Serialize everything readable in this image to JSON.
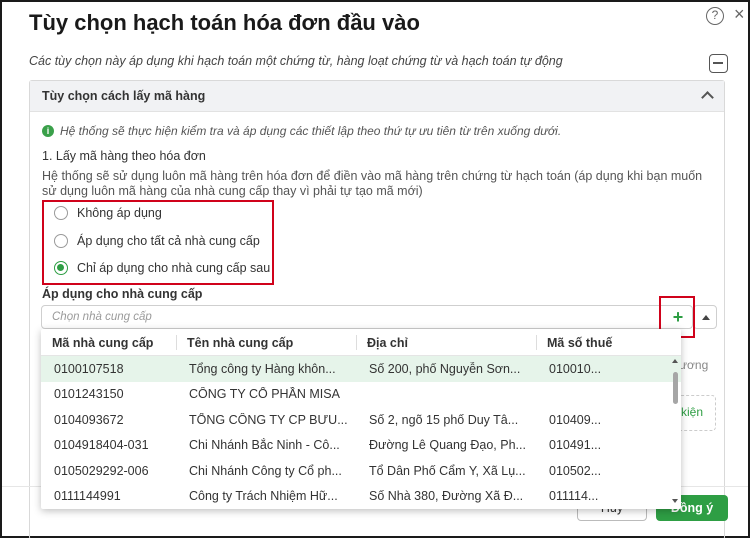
{
  "dialog": {
    "title": "Tùy chọn hạch toán hóa đơn đầu vào",
    "subtitle": "Các tùy chọn này áp dụng khi hạch toán một chứng từ, hàng loạt chứng từ và hạch toán tự động",
    "help_icon": "?",
    "close_icon": "×"
  },
  "section": {
    "title": "Tùy chọn cách lấy mã hàng",
    "info": "Hệ thống sẽ thực hiện kiểm tra và áp dụng các thiết lập theo thứ tự ưu tiên từ trên xuống dưới.",
    "info_icon": "i",
    "option_title": "1. Lấy mã hàng theo hóa đơn",
    "description": "Hệ thống sẽ sử dụng luôn mã hàng trên hóa đơn để điền vào mã hàng trên chứng từ hạch toán (áp dụng khi bạn muốn sử dụng luôn mã hàng của nhà cung cấp thay vì phải tự tạo mã mới)",
    "radios": [
      {
        "label": "Không áp dụng",
        "checked": false
      },
      {
        "label": "Áp dụng cho tất cả nhà cung cấp",
        "checked": false
      },
      {
        "label": "Chỉ áp dụng cho nhà cung cấp sau",
        "checked": true
      }
    ],
    "apply_label": "Áp dụng cho nhà cung cấp",
    "select_placeholder": "Chọn nhà cung cấp",
    "add_label": "+"
  },
  "supplier_dropdown": {
    "columns": [
      "Mã nhà cung cấp",
      "Tên nhà cung cấp",
      "Địa chỉ",
      "Mã số thuế"
    ],
    "rows": [
      {
        "code": "0100107518",
        "name": "Tổng công ty Hàng khôn...",
        "address": "Số 200, phố Nguyễn Sơn...",
        "tax": "010010...",
        "selected": true
      },
      {
        "code": "0101243150",
        "name": "CÔNG TY CỔ PHẦN MISA",
        "address": "",
        "tax": "",
        "selected": false
      },
      {
        "code": "0104093672",
        "name": "TỔNG CÔNG TY CP BƯU...",
        "address": "Số 2, ngõ 15 phố Duy Tâ...",
        "tax": "010409...",
        "selected": false
      },
      {
        "code": "0104918404-031",
        "name": "Chi Nhánh Bắc Ninh - Cô...",
        "address": "Đường Lê Quang Đạo, Ph...",
        "tax": "010491...",
        "selected": false
      },
      {
        "code": "0105029292-006",
        "name": "Chi Nhánh Công ty Cổ ph...",
        "address": "Tổ Dân Phố Cẩm Y, Xã Lụ...",
        "tax": "010502...",
        "selected": false
      },
      {
        "code": "0111144991",
        "name": "Công ty Trách Nhiệm Hữ...",
        "address": "Số Nhà 380, Đường Xã Đ...",
        "tax": "011114...",
        "selected": false
      }
    ]
  },
  "background": {
    "partial_text_1": "ương",
    "partial_text_2": "kiện"
  },
  "footer": {
    "cancel_label": "Hủy",
    "ok_label": "Đồng ý"
  },
  "colors": {
    "accent": "#2e9e44",
    "highlight_border": "#d0021b",
    "selected_row": "#e6f4ea"
  }
}
